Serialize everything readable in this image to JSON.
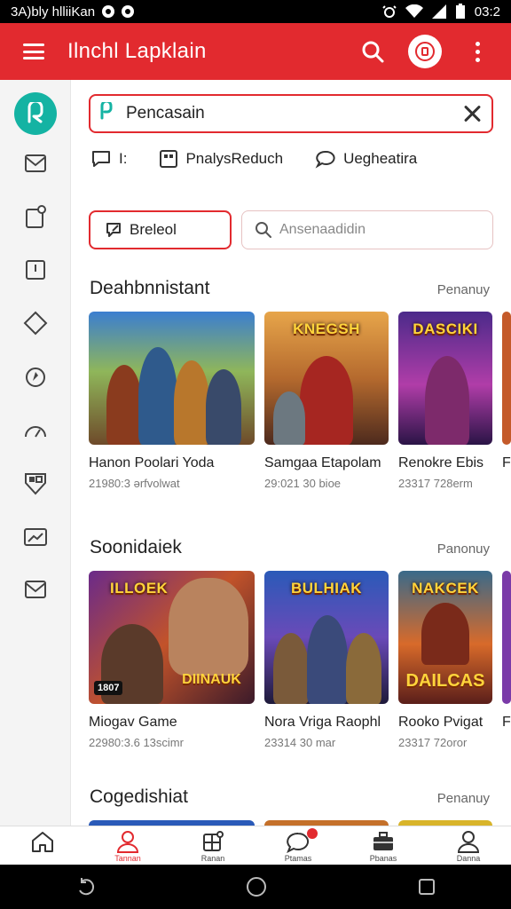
{
  "status_bar": {
    "left_text": "3A)bly hlliiKan",
    "time": "03:2"
  },
  "app_bar": {
    "title": "Ilnchl Lapklain"
  },
  "search": {
    "value": "Pencasain"
  },
  "chips": [
    {
      "label": "I:"
    },
    {
      "label": "PnalysReduch"
    },
    {
      "label": "Uegheatira"
    }
  ],
  "filter_button": {
    "label": "Breleol"
  },
  "secondary_search": {
    "placeholder": "Ansenaadidin"
  },
  "sections": [
    {
      "title": "Deahbnnistant",
      "more": "Penanuy",
      "cards": [
        {
          "name": "Hanon Poolari Yoda",
          "meta": "21980:3 ərfvolwat",
          "art_title": ""
        },
        {
          "name": "Samgaa Etapolam",
          "meta": "29:021 30 bioe",
          "art_title": "KNEGSH"
        },
        {
          "name": "Renokre Ebis",
          "meta": "23317 728erm",
          "art_title": "DASCIKI"
        },
        {
          "name": "F",
          "meta": ""
        }
      ]
    },
    {
      "title": "Soonidaiek",
      "more": "Panonuy",
      "cards": [
        {
          "name": "Miogav Game",
          "meta": "22980:3.6 13scimr",
          "art_title": "ILLOEK",
          "art_bottom": "DIINAUK",
          "art_tag": "1807"
        },
        {
          "name": "Nora Vriga Raophl",
          "meta": "23314 30 mar",
          "art_title": "BULHIAK"
        },
        {
          "name": "Rooko Pvigat",
          "meta": "23317 72oror",
          "art_title": "NAKCEK",
          "art_bottom": "DAILCAS"
        },
        {
          "name": "F",
          "meta": ""
        }
      ]
    },
    {
      "title": "Cogedishiat",
      "more": "Penanuy"
    }
  ],
  "bottom_nav": [
    {
      "label": ""
    },
    {
      "label": "Tannan"
    },
    {
      "label": "Ranan"
    },
    {
      "label": "Ptamas"
    },
    {
      "label": "Pbanas"
    },
    {
      "label": "Danna"
    }
  ],
  "colors": {
    "accent": "#e22a2f",
    "brand_teal": "#14b3a3"
  }
}
